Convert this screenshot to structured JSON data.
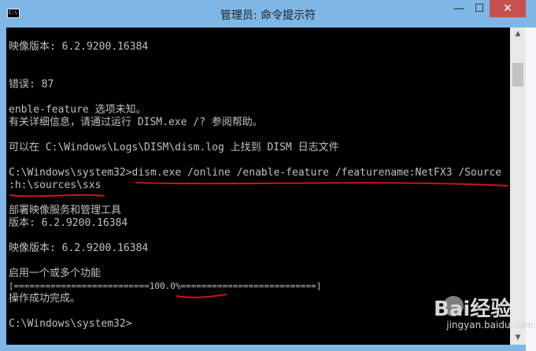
{
  "window": {
    "title": "管理员: 命令提示符",
    "icon_text": "C:\\",
    "minimize_glyph": "—",
    "maximize_glyph": "☐",
    "close_glyph": "✕"
  },
  "console": {
    "lines": [
      "映像版本: 6.2.9200.16384",
      "错误: 87",
      "enble-feature 选项未知。",
      "有关详细信息，请通过运行 DISM.exe /? 参阅帮助。",
      "可以在 C:\\Windows\\Logs\\DISM\\dism.log 上找到 DISM 日志文件",
      "C:\\Windows\\system32>dism.exe /online /enable-feature /featurename:NetFX3 /Source",
      ":h:\\sources\\sxs",
      "部署映像服务和管理工具",
      "版本: 6.2.9200.16384",
      "映像版本: 6.2.9200.16384",
      "启用一个或多个功能",
      "[==========================100.0%==========================]",
      "操作成功完成。",
      "C:\\Windows\\system32>"
    ],
    "progress_percent": 100.0
  },
  "scrollbar": {
    "up_glyph": "▲",
    "down_glyph": "▼"
  },
  "watermark": {
    "brand": "Bai经验",
    "url": "jingyan.baidu.com"
  },
  "colors": {
    "titlebar": "#7eb7e6",
    "close_button": "#c7504f",
    "console_bg": "#000000",
    "console_text": "#c0c0c0",
    "annotation_red": "#c8161d"
  }
}
